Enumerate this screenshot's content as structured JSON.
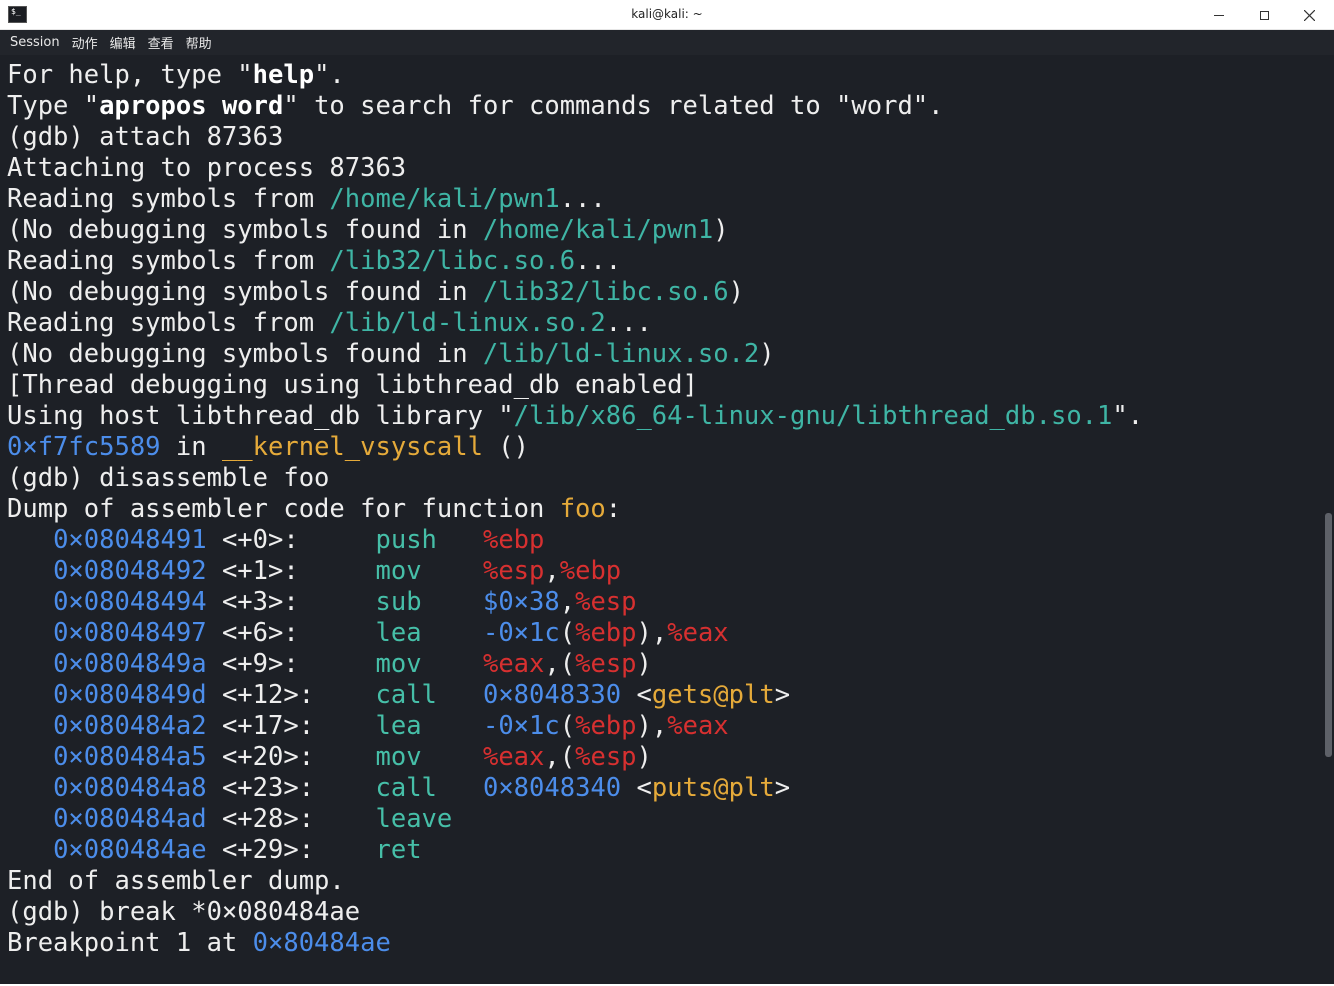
{
  "window": {
    "title": "kali@kali: ~",
    "icon": "terminal-icon",
    "buttons": [
      "minimize-icon",
      "maximize-icon",
      "close-icon"
    ]
  },
  "menu": [
    "Session",
    "动作",
    "编辑",
    "查看",
    "帮助"
  ],
  "colors": {
    "background": "#1d2026",
    "text": "#eeeeee",
    "path": "#3fb5a5",
    "address": "#4c8dea",
    "function": "#e5aa3a",
    "instruction": "#46bfa8",
    "register": "#d73030"
  },
  "terminal": {
    "lines": [
      [
        {
          "t": "For help, type \"",
          "c": ""
        },
        {
          "t": "help",
          "c": "b"
        },
        {
          "t": "\".",
          "c": ""
        }
      ],
      [
        {
          "t": "Type \"",
          "c": ""
        },
        {
          "t": "apropos word",
          "c": "b"
        },
        {
          "t": "\" to search for commands related to \"word\".",
          "c": ""
        }
      ],
      [
        {
          "t": "(gdb) attach 87363",
          "c": ""
        }
      ],
      [
        {
          "t": "Attaching to process 87363",
          "c": ""
        }
      ],
      [
        {
          "t": "Reading symbols from ",
          "c": ""
        },
        {
          "t": "/home/kali/pwn1",
          "c": "path"
        },
        {
          "t": "...",
          "c": ""
        }
      ],
      [
        {
          "t": "(No debugging symbols found in ",
          "c": ""
        },
        {
          "t": "/home/kali/pwn1",
          "c": "path"
        },
        {
          "t": ")",
          "c": ""
        }
      ],
      [
        {
          "t": "Reading symbols from ",
          "c": ""
        },
        {
          "t": "/lib32/libc.so.6",
          "c": "path"
        },
        {
          "t": "...",
          "c": ""
        }
      ],
      [
        {
          "t": "(No debugging symbols found in ",
          "c": ""
        },
        {
          "t": "/lib32/libc.so.6",
          "c": "path"
        },
        {
          "t": ")",
          "c": ""
        }
      ],
      [
        {
          "t": "Reading symbols from ",
          "c": ""
        },
        {
          "t": "/lib/ld-linux.so.2",
          "c": "path"
        },
        {
          "t": "...",
          "c": ""
        }
      ],
      [
        {
          "t": "(No debugging symbols found in ",
          "c": ""
        },
        {
          "t": "/lib/ld-linux.so.2",
          "c": "path"
        },
        {
          "t": ")",
          "c": ""
        }
      ],
      [
        {
          "t": "[Thread debugging using libthread_db enabled]",
          "c": ""
        }
      ],
      [
        {
          "t": "Using host libthread_db library \"",
          "c": ""
        },
        {
          "t": "/lib/x86_64-linux-gnu/libthread_db.so.1",
          "c": "path"
        },
        {
          "t": "\".",
          "c": ""
        }
      ],
      [
        {
          "t": "0×f7fc5589",
          "c": "addr"
        },
        {
          "t": " in ",
          "c": ""
        },
        {
          "t": "__kernel_vsyscall",
          "c": "fn"
        },
        {
          "t": " ()",
          "c": ""
        }
      ],
      [
        {
          "t": "(gdb) disassemble foo",
          "c": ""
        }
      ],
      [
        {
          "t": "Dump of assembler code for function ",
          "c": ""
        },
        {
          "t": "foo",
          "c": "fn"
        },
        {
          "t": ":",
          "c": ""
        }
      ],
      [
        {
          "t": "   ",
          "c": ""
        },
        {
          "t": "0×08048491",
          "c": "addr"
        },
        {
          "t": " <+0>:     ",
          "c": "off"
        },
        {
          "t": "push",
          "c": "ins"
        },
        {
          "t": "   ",
          "c": ""
        },
        {
          "t": "%ebp",
          "c": "reg"
        }
      ],
      [
        {
          "t": "   ",
          "c": ""
        },
        {
          "t": "0×08048492",
          "c": "addr"
        },
        {
          "t": " <+1>:     ",
          "c": "off"
        },
        {
          "t": "mov",
          "c": "ins"
        },
        {
          "t": "    ",
          "c": ""
        },
        {
          "t": "%esp",
          "c": "reg"
        },
        {
          "t": ",",
          "c": ""
        },
        {
          "t": "%ebp",
          "c": "reg"
        }
      ],
      [
        {
          "t": "   ",
          "c": ""
        },
        {
          "t": "0×08048494",
          "c": "addr"
        },
        {
          "t": " <+3>:     ",
          "c": "off"
        },
        {
          "t": "sub",
          "c": "ins"
        },
        {
          "t": "    ",
          "c": ""
        },
        {
          "t": "$0×38",
          "c": "num"
        },
        {
          "t": ",",
          "c": ""
        },
        {
          "t": "%esp",
          "c": "reg"
        }
      ],
      [
        {
          "t": "   ",
          "c": ""
        },
        {
          "t": "0×08048497",
          "c": "addr"
        },
        {
          "t": " <+6>:     ",
          "c": "off"
        },
        {
          "t": "lea",
          "c": "ins"
        },
        {
          "t": "    ",
          "c": ""
        },
        {
          "t": "-0×1c",
          "c": "num"
        },
        {
          "t": "(",
          "c": ""
        },
        {
          "t": "%ebp",
          "c": "reg"
        },
        {
          "t": "),",
          "c": ""
        },
        {
          "t": "%eax",
          "c": "reg"
        }
      ],
      [
        {
          "t": "   ",
          "c": ""
        },
        {
          "t": "0×0804849a",
          "c": "addr"
        },
        {
          "t": " <+9>:     ",
          "c": "off"
        },
        {
          "t": "mov",
          "c": "ins"
        },
        {
          "t": "    ",
          "c": ""
        },
        {
          "t": "%eax",
          "c": "reg"
        },
        {
          "t": ",(",
          "c": ""
        },
        {
          "t": "%esp",
          "c": "reg"
        },
        {
          "t": ")",
          "c": ""
        }
      ],
      [
        {
          "t": "   ",
          "c": ""
        },
        {
          "t": "0×0804849d",
          "c": "addr"
        },
        {
          "t": " <+12>:    ",
          "c": "off"
        },
        {
          "t": "call",
          "c": "ins"
        },
        {
          "t": "   ",
          "c": ""
        },
        {
          "t": "0×8048330",
          "c": "num"
        },
        {
          "t": " <",
          "c": ""
        },
        {
          "t": "gets@plt",
          "c": "fn"
        },
        {
          "t": ">",
          "c": ""
        }
      ],
      [
        {
          "t": "   ",
          "c": ""
        },
        {
          "t": "0×080484a2",
          "c": "addr"
        },
        {
          "t": " <+17>:    ",
          "c": "off"
        },
        {
          "t": "lea",
          "c": "ins"
        },
        {
          "t": "    ",
          "c": ""
        },
        {
          "t": "-0×1c",
          "c": "num"
        },
        {
          "t": "(",
          "c": ""
        },
        {
          "t": "%ebp",
          "c": "reg"
        },
        {
          "t": "),",
          "c": ""
        },
        {
          "t": "%eax",
          "c": "reg"
        }
      ],
      [
        {
          "t": "   ",
          "c": ""
        },
        {
          "t": "0×080484a5",
          "c": "addr"
        },
        {
          "t": " <+20>:    ",
          "c": "off"
        },
        {
          "t": "mov",
          "c": "ins"
        },
        {
          "t": "    ",
          "c": ""
        },
        {
          "t": "%eax",
          "c": "reg"
        },
        {
          "t": ",(",
          "c": ""
        },
        {
          "t": "%esp",
          "c": "reg"
        },
        {
          "t": ")",
          "c": ""
        }
      ],
      [
        {
          "t": "   ",
          "c": ""
        },
        {
          "t": "0×080484a8",
          "c": "addr"
        },
        {
          "t": " <+23>:    ",
          "c": "off"
        },
        {
          "t": "call",
          "c": "ins"
        },
        {
          "t": "   ",
          "c": ""
        },
        {
          "t": "0×8048340",
          "c": "num"
        },
        {
          "t": " <",
          "c": ""
        },
        {
          "t": "puts@plt",
          "c": "fn"
        },
        {
          "t": ">",
          "c": ""
        }
      ],
      [
        {
          "t": "   ",
          "c": ""
        },
        {
          "t": "0×080484ad",
          "c": "addr"
        },
        {
          "t": " <+28>:    ",
          "c": "off"
        },
        {
          "t": "leave",
          "c": "ins"
        }
      ],
      [
        {
          "t": "   ",
          "c": ""
        },
        {
          "t": "0×080484ae",
          "c": "addr"
        },
        {
          "t": " <+29>:    ",
          "c": "off"
        },
        {
          "t": "ret",
          "c": "ins"
        }
      ],
      [
        {
          "t": "End of assembler dump.",
          "c": ""
        }
      ],
      [
        {
          "t": "(gdb) break *0×080484ae",
          "c": ""
        }
      ],
      [
        {
          "t": "Breakpoint 1 at ",
          "c": ""
        },
        {
          "t": "0×80484ae",
          "c": "addr"
        }
      ]
    ]
  }
}
